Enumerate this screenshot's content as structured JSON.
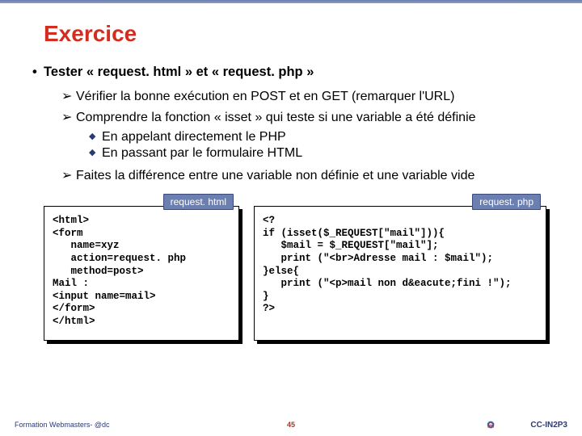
{
  "title": "Exercice",
  "main": "Tester « request. html » et « request. php »",
  "p1": "Vérifier la bonne exécution en POST et en GET (remarquer l'URL)",
  "p2": "Comprendre la fonction « isset » qui teste si une variable a été définie",
  "p2a": "En appelant directement le PHP",
  "p2b": "En passant par le formulaire HTML",
  "p3": "Faites la différence entre une variable non définie et une variable vide",
  "tab1": "request. html",
  "tab2": "request. php",
  "code1": "<html>\n<form\n   name=xyz\n   action=request. php\n   method=post>\nMail :\n<input name=mail>\n</form>\n</html>",
  "code2": "<?\nif (isset($_REQUEST[\"mail\"])){\n   $mail = $_REQUEST[\"mail\"];\n   print (\"<br>Adresse mail : $mail\");\n}else{\n   print (\"<p>mail non d&eacute;fini !\");\n}\n?>",
  "footL": "Formation Webmasters- @dc",
  "footM": "45",
  "footR": "CC-IN2P3"
}
